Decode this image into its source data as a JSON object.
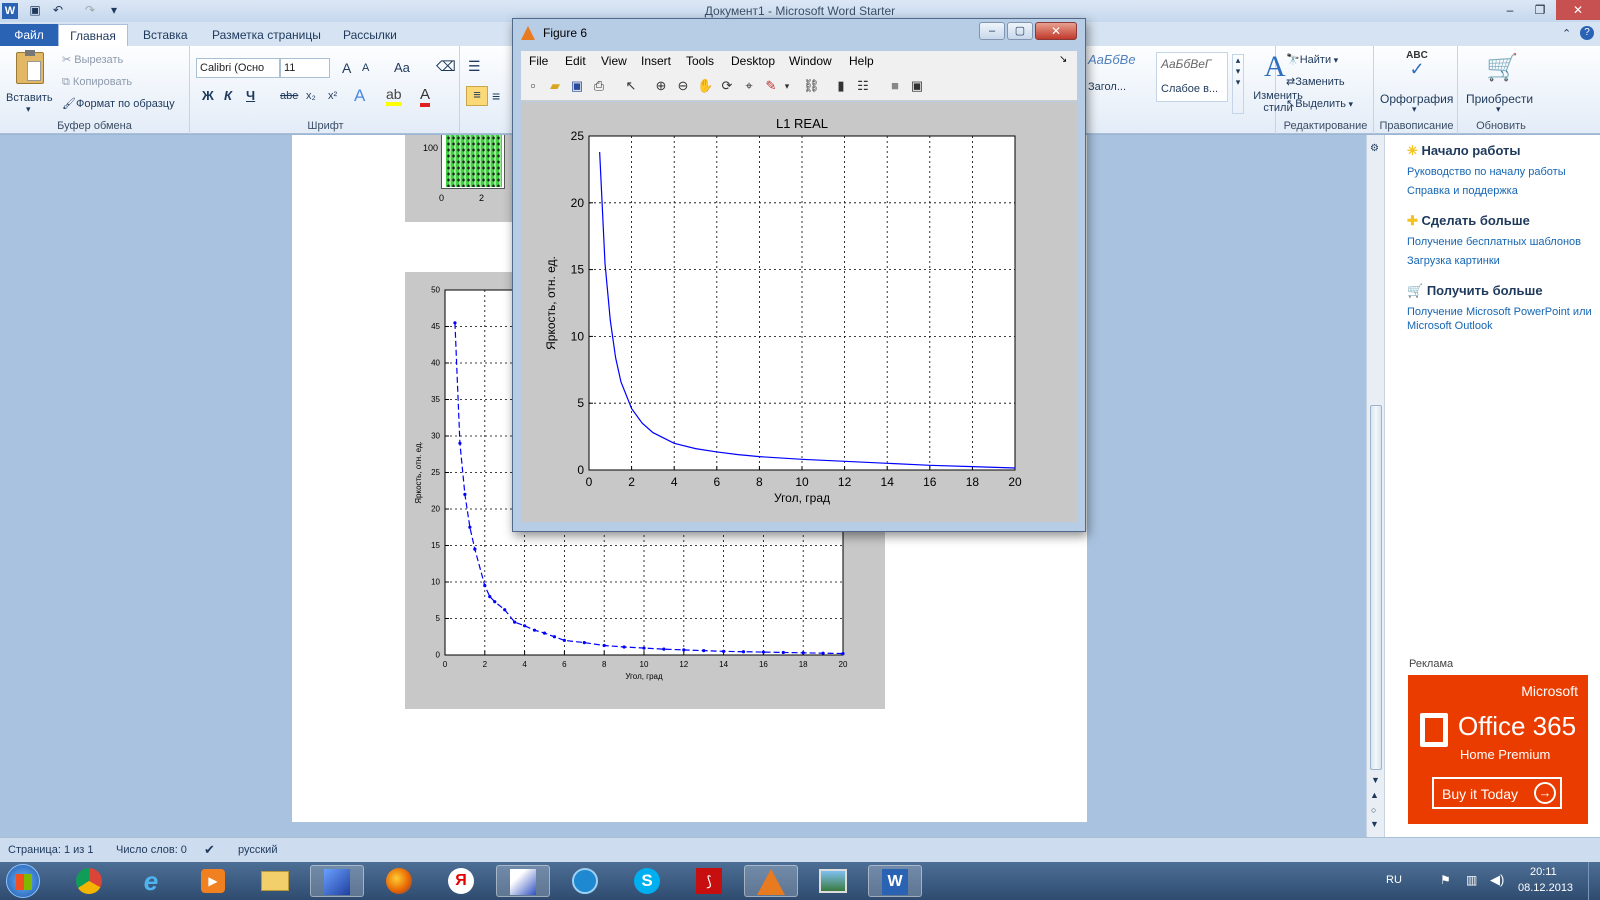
{
  "window": {
    "title": "Документ1 - Microsoft Word Starter",
    "minimize": "–",
    "maximize": "❐",
    "close": "✕"
  },
  "tabs": [
    "Файл",
    "Главная",
    "Вставка",
    "Разметка страницы",
    "Рассылки"
  ],
  "ribbon": {
    "clipboard": {
      "paste": "Вставить",
      "cut": "Вырезать",
      "copy": "Копировать",
      "format_painter": "Формат по образцу",
      "label": "Буфер обмена"
    },
    "font": {
      "family": "Calibri (Осно",
      "size": "11",
      "bold": "Ж",
      "italic": "К",
      "underline": "Ч",
      "strike": "abe",
      "subscript": "x₂",
      "superscript": "x²",
      "grow": "A",
      "shrink": "A",
      "case": "Aa",
      "label": "Шрифт"
    },
    "styles": {
      "sample1": "АаБбВе",
      "sample2": "АаБбВеГ",
      "name1": "Загол...",
      "name2": "Слабое в...",
      "change_styles": "Изменить стили"
    },
    "editing": {
      "find": "Найти",
      "replace": "Заменить",
      "select": "Выделить",
      "label": "Редактирование"
    },
    "proofing": {
      "spelling": "Орфография",
      "icon_text": "ABC",
      "label": "Правописание"
    },
    "update": {
      "acquire": "Приобрести",
      "label": "Обновить"
    }
  },
  "side_pane": {
    "section1": {
      "title": "Начало работы",
      "links": [
        "Руководство по началу работы",
        "Справка и поддержка"
      ]
    },
    "section2": {
      "title": "Сделать больше",
      "links": [
        "Получение бесплатных шаблонов",
        "Загрузка картинки"
      ]
    },
    "section3": {
      "title": "Получить больше",
      "links": [
        "Получение Microsoft PowerPoint или Microsoft Outlook"
      ]
    },
    "ad": {
      "label": "Реклама",
      "brand": "Microsoft",
      "product": "Office 365",
      "edition": "Home Premium",
      "cta": "Buy it Today"
    }
  },
  "status_bar": {
    "page": "Страница: 1 из 1",
    "words": "Число слов: 0",
    "language": "русский"
  },
  "taskbar": {
    "lang": "RU",
    "time": "20:11",
    "date": "08.12.2013"
  },
  "doc_image_1": {
    "ytick": "100",
    "xticks": [
      "0",
      "2"
    ]
  },
  "figure": {
    "title": "Figure 6",
    "menu": [
      "File",
      "Edit",
      "View",
      "Insert",
      "Tools",
      "Desktop",
      "Window",
      "Help"
    ]
  },
  "colors": {
    "line": "#0000ff",
    "ribbon_blue": "#2a62b4",
    "office_orange": "#eb3c00"
  },
  "chart_data": [
    {
      "type": "line",
      "title": "L1 REAL",
      "xlabel": "Угол, град",
      "ylabel": "Яркость, отн. ед.",
      "xlim": [
        0,
        20
      ],
      "ylim": [
        0,
        25
      ],
      "xticks": [
        0,
        2,
        4,
        6,
        8,
        10,
        12,
        14,
        16,
        18,
        20
      ],
      "yticks": [
        0,
        5,
        10,
        15,
        20,
        25
      ],
      "grid": true,
      "series": [
        {
          "x": [
            0.5,
            0.75,
            1,
            1.25,
            1.5,
            2,
            2.5,
            3,
            4,
            5,
            6,
            7,
            8,
            10,
            12,
            14,
            16,
            18,
            20
          ],
          "y": [
            23.8,
            15.5,
            11.2,
            8.4,
            6.6,
            4.6,
            3.5,
            2.8,
            2.0,
            1.6,
            1.35,
            1.15,
            1.0,
            0.8,
            0.65,
            0.5,
            0.35,
            0.25,
            0.15
          ]
        }
      ]
    },
    {
      "type": "line",
      "title": "",
      "xlabel": "Угол, град",
      "ylabel": "Яркость, отн. ед.",
      "xlim": [
        0,
        20
      ],
      "ylim": [
        0,
        50
      ],
      "xticks": [
        0,
        2,
        4,
        6,
        8,
        10,
        12,
        14,
        16,
        18,
        20
      ],
      "yticks": [
        0,
        5,
        10,
        15,
        20,
        25,
        30,
        35,
        40,
        45,
        50
      ],
      "grid": true,
      "series": [
        {
          "x": [
            0.5,
            0.75,
            1,
            1.25,
            1.5,
            2,
            2.25,
            2.5,
            3,
            3.5,
            4,
            4.5,
            5,
            5.5,
            6,
            7,
            8,
            9,
            10,
            11,
            12,
            13,
            14,
            15,
            16,
            17,
            18,
            19,
            20
          ],
          "y": [
            45.5,
            29,
            22,
            17.5,
            14.5,
            9.5,
            8,
            7.3,
            6.2,
            4.5,
            4,
            3.4,
            3,
            2.5,
            2,
            1.7,
            1.3,
            1.1,
            0.95,
            0.8,
            0.7,
            0.6,
            0.5,
            0.45,
            0.4,
            0.35,
            0.3,
            0.25,
            0.2
          ]
        }
      ]
    }
  ]
}
